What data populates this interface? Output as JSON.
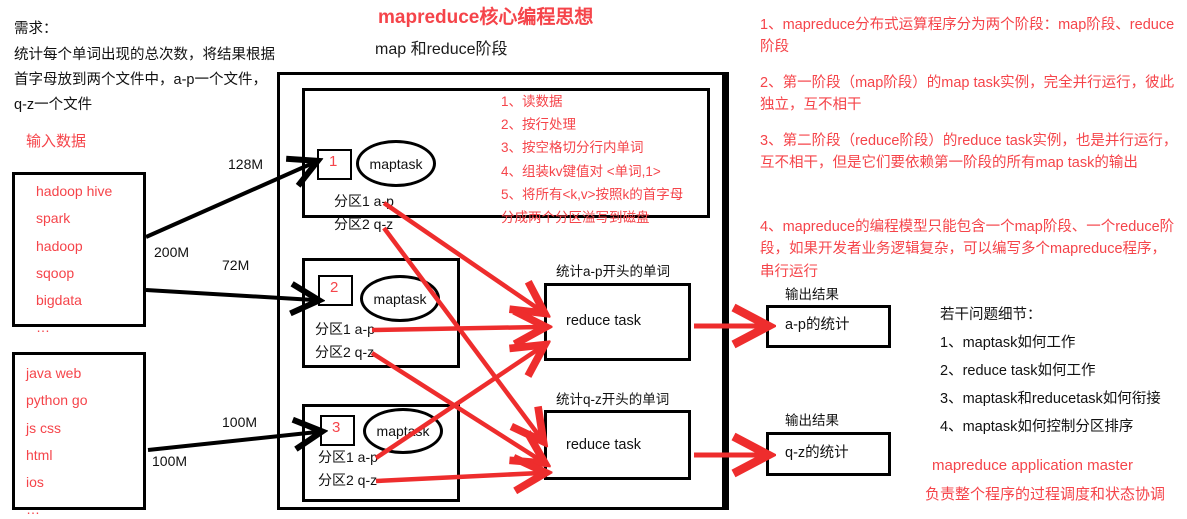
{
  "header": {
    "title": "mapreduce核心编程思想",
    "subtitle": "map 和reduce阶段"
  },
  "requirement": {
    "label": "需求：",
    "line1": "统计每个单词出现的总次数，将结果根据",
    "line2": "首字母放到两个文件中，a-p一个文件，",
    "line3": "q-z一个文件"
  },
  "input": {
    "heading": "输入数据",
    "block1": [
      "hadoop hive",
      "spark",
      "hadoop",
      "sqoop",
      "bigdata",
      "…"
    ],
    "block2": [
      "java web",
      "python go",
      "js css",
      "html",
      "ios",
      "…"
    ]
  },
  "split_labels": {
    "s128": "128M",
    "s200": "200M",
    "s72": "72M",
    "s100a": "100M",
    "s100b": "100M"
  },
  "maptasks": [
    {
      "number": "1",
      "name": "maptask",
      "partition1": "分区1 a-p",
      "partition2": "分区2 q-z"
    },
    {
      "number": "2",
      "name": "maptask",
      "partition1": "分区1 a-p",
      "partition2": "分区2 q-z"
    },
    {
      "number": "3",
      "name": "maptask",
      "partition1": "分区1 a-p",
      "partition2": "分区2 q-z"
    }
  ],
  "map_steps": [
    "1、读数据",
    "2、按行处理",
    "3、按空格切分行内单词",
    "4、组装kv键值对 <单词,1>",
    "5、将所有<k,v>按照k的首字母",
    "分成两个分区溢写到磁盘"
  ],
  "reduce": [
    {
      "caption": "统计a-p开头的单词",
      "name": "reduce task"
    },
    {
      "caption": "统计q-z开头的单词",
      "name": "reduce task"
    }
  ],
  "outputs": [
    {
      "caption": "输出结果",
      "name": "a-p的统计"
    },
    {
      "caption": "输出结果",
      "name": "q-z的统计"
    }
  ],
  "notes": {
    "items": [
      "1、mapreduce分布式运算程序分为两个阶段：map阶段、reduce阶段",
      "2、第一阶段（map阶段）的map task实例，完全并行运行，彼此独立，互不相干",
      "3、第二阶段（reduce阶段）的reduce task实例，也是并行运行，互不相干，但是它们要依赖第一阶段的所有map task的输出",
      "4、mapreduce的编程模型只能包含一个map阶段、一个reduce阶段，如果开发者业务逻辑复杂，可以编写多个mapreduce程序，串行运行"
    ]
  },
  "details": {
    "heading": "若干问题细节：",
    "items": [
      "1、maptask如何工作",
      "2、reduce task如何工作",
      "3、maptask和reducetask如何衔接",
      "4、maptask如何控制分区排序"
    ]
  },
  "master": {
    "title": "mapreduce application master",
    "desc": "负责整个程序的过程调度和状态协调"
  },
  "colors": {
    "accent_red": "#f5444a",
    "ink": "#000000"
  }
}
